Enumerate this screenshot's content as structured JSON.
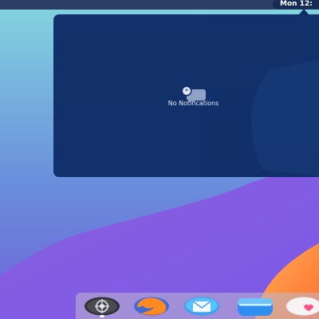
{
  "topbar": {
    "clock": "Mon 12:"
  },
  "notifications": {
    "empty_text": "No Notifications"
  },
  "dock": {
    "items": [
      {
        "name": "settings",
        "icon": "system-settings-icon"
      },
      {
        "name": "browser",
        "icon": "firefox-icon"
      },
      {
        "name": "mail",
        "icon": "mail-icon"
      },
      {
        "name": "files",
        "icon": "files-icon"
      },
      {
        "name": "heart",
        "icon": "heart-app-icon"
      }
    ]
  },
  "colors": {
    "topbar": "#2c3e63",
    "popover": "#102e68",
    "wallpaper_top": "#82c9d8",
    "wallpaper_bottom": "#7f5ee3",
    "accent_orange": "#ff8a34"
  }
}
